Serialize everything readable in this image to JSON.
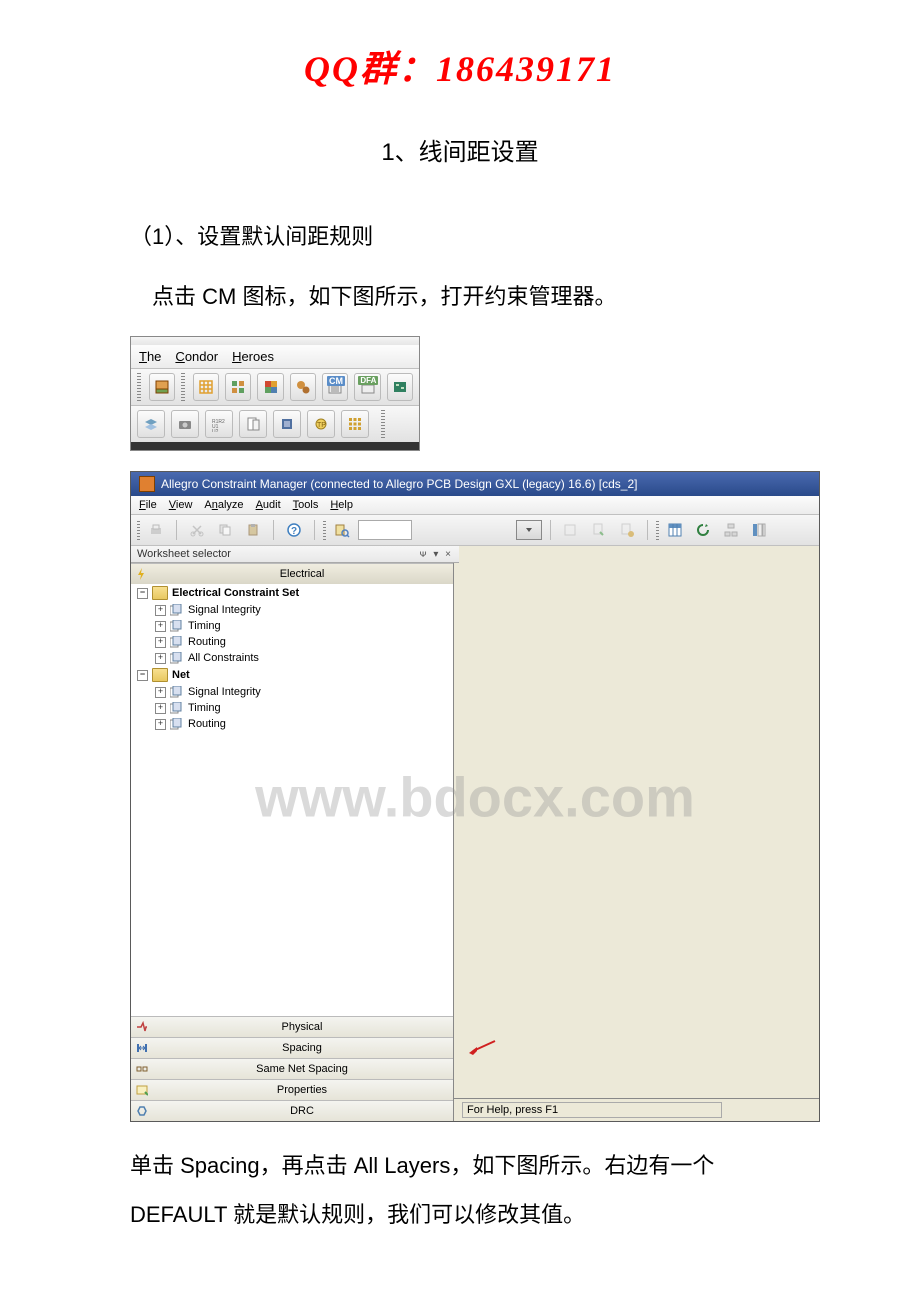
{
  "header": {
    "qq_line": "QQ群：186439171"
  },
  "section": {
    "title": "1、线间距设置"
  },
  "sub1": {
    "title": "（1）、设置默认间距规则"
  },
  "body1": {
    "text": "点击 CM 图标，如下图所示，打开约束管理器。"
  },
  "toolbar": {
    "menu": {
      "the": "The",
      "condor": "Condor",
      "heroes": "Heroes"
    }
  },
  "cm": {
    "title": "Allegro Constraint Manager (connected to Allegro PCB Design GXL (legacy) 16.6) [cds_2]",
    "menu": {
      "file": "File",
      "view": "View",
      "analyze": "Analyze",
      "audit": "Audit",
      "tools": "Tools",
      "help": "Help"
    },
    "ws_label": "Worksheet selector",
    "ws_ctrl": "ᴪ  ▾  ×",
    "tabs": {
      "electrical": "Electrical",
      "physical": "Physical",
      "spacing": "Spacing",
      "samenet": "Same Net Spacing",
      "properties": "Properties",
      "drc": "DRC"
    },
    "tree": {
      "ecs": "Electrical Constraint Set",
      "si": "Signal Integrity",
      "timing": "Timing",
      "routing": "Routing",
      "allc": "All Constraints",
      "net": "Net"
    },
    "status": "For Help, press F1"
  },
  "footer": {
    "line1": "单击 Spacing，再点击 All Layers，如下图所示。右边有一个",
    "line2": "DEFAULT 就是默认规则，我们可以修改其值。"
  },
  "watermark": "www.bdocx.com"
}
